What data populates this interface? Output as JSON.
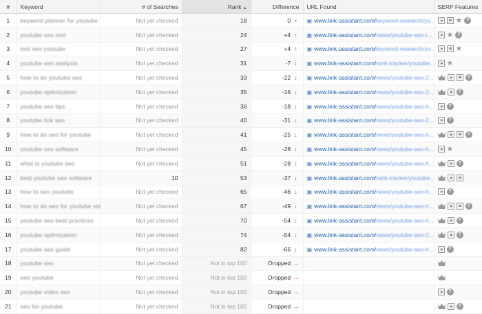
{
  "headers": {
    "num": "#",
    "keyword": "Keyword",
    "searches": "# of Searches",
    "rank": "Rank",
    "difference": "Difference",
    "url": "URL Found",
    "serp": "SERP Features"
  },
  "sort_indicator": "▲",
  "url_domain": "www.link-assistant.com/",
  "rows": [
    {
      "num": "1",
      "keyword": "keyword planner for youtube",
      "searches": "Not yet checked",
      "rank": "18",
      "diff": "0",
      "dir": "none",
      "url_path": "keyword-research/yo...",
      "serp": [
        "play",
        "doc",
        "star",
        "q"
      ]
    },
    {
      "num": "2",
      "keyword": "youtube seo tool",
      "searches": "Not yet checked",
      "rank": "24",
      "diff": "+4",
      "dir": "up",
      "url_path": "news/youtube-seo-t...",
      "serp": [
        "play",
        "star",
        "q"
      ]
    },
    {
      "num": "3",
      "keyword": "tool seo youtube",
      "searches": "Not yet checked",
      "rank": "27",
      "diff": "+4",
      "dir": "up",
      "url_path": "keyword-research/yo...",
      "serp": [
        "play",
        "doc",
        "star"
      ]
    },
    {
      "num": "4",
      "keyword": "youtube seo analysis",
      "searches": "Not yet checked",
      "rank": "31",
      "diff": "-7",
      "dir": "down",
      "url_path": "rank-tracker/youtube...",
      "serp": [
        "play",
        "star"
      ]
    },
    {
      "num": "5",
      "keyword": "how to do youtube seo",
      "searches": "Not yet checked",
      "rank": "33",
      "diff": "-22",
      "dir": "down",
      "url_path": "news/youtube-seo-2...",
      "serp": [
        "crown",
        "play",
        "doc",
        "q"
      ]
    },
    {
      "num": "6",
      "keyword": "youtube optimization",
      "searches": "Not yet checked",
      "rank": "35",
      "diff": "-16",
      "dir": "down",
      "url_path": "news/youtube-seo-2...",
      "serp": [
        "crown",
        "play",
        "q"
      ]
    },
    {
      "num": "7",
      "keyword": "youtube seo tips",
      "searches": "Not yet checked",
      "rank": "36",
      "diff": "-18",
      "dir": "down",
      "url_path": "news/youtube-seo-h...",
      "serp": [
        "play",
        "q"
      ]
    },
    {
      "num": "8",
      "keyword": "youtube link seo",
      "searches": "Not yet checked",
      "rank": "40",
      "diff": "-31",
      "dir": "down",
      "url_path": "news/youtube-seo-2...",
      "serp": [
        "play",
        "q"
      ]
    },
    {
      "num": "9",
      "keyword": "how to do seo for youtube",
      "searches": "Not yet checked",
      "rank": "41",
      "diff": "-25",
      "dir": "down",
      "url_path": "news/youtube-seo-h...",
      "serp": [
        "crown",
        "play",
        "doc",
        "q"
      ]
    },
    {
      "num": "10",
      "keyword": "youtube seo software",
      "searches": "Not yet checked",
      "rank": "45",
      "diff": "-28",
      "dir": "down",
      "url_path": "news/youtube-seo-h...",
      "serp": [
        "play",
        "star"
      ]
    },
    {
      "num": "11",
      "keyword": "what is youtube seo",
      "searches": "Not yet checked",
      "rank": "51",
      "diff": "-28",
      "dir": "down",
      "url_path": "news/youtube-seo-h...",
      "serp": [
        "crown",
        "play",
        "q"
      ]
    },
    {
      "num": "12",
      "keyword": "best youtube seo software",
      "searches": "10",
      "rank": "53",
      "diff": "-37",
      "dir": "down",
      "url_path": "rank-tracker/youtube...",
      "serp": [
        "crown",
        "play",
        "doc"
      ]
    },
    {
      "num": "13",
      "keyword": "how to seo youtube",
      "searches": "Not yet checked",
      "rank": "65",
      "diff": "-46",
      "dir": "down",
      "url_path": "news/youtube-seo-h...",
      "serp": [
        "play",
        "q"
      ]
    },
    {
      "num": "14",
      "keyword": "how to do seo for youtube videos",
      "searches": "Not yet checked",
      "rank": "67",
      "diff": "-49",
      "dir": "down",
      "url_path": "news/youtube-seo-h...",
      "serp": [
        "crown",
        "play",
        "doc",
        "q"
      ]
    },
    {
      "num": "15",
      "keyword": "youtube seo best practices",
      "searches": "Not yet checked",
      "rank": "70",
      "diff": "-54",
      "dir": "down",
      "url_path": "news/youtube-seo-h...",
      "serp": [
        "crown",
        "play",
        "q"
      ]
    },
    {
      "num": "16",
      "keyword": "youtube optimization",
      "searches": "Not yet checked",
      "rank": "74",
      "diff": "-54",
      "dir": "down",
      "url_path": "news/youtube-seo-2...",
      "serp": [
        "crown",
        "play",
        "q"
      ]
    },
    {
      "num": "17",
      "keyword": "youtube seo guide",
      "searches": "Not yet checked",
      "rank": "82",
      "diff": "-66",
      "dir": "down",
      "url_path": "news/youtube-seo-h...",
      "serp": [
        "play",
        "q"
      ]
    },
    {
      "num": "18",
      "keyword": "youtube seo",
      "searches": "Not yet checked",
      "rank": "Not in top 100",
      "diff": "Dropped",
      "dir": "drop",
      "url_path": "",
      "serp": [
        "crown"
      ]
    },
    {
      "num": "19",
      "keyword": "seo youtube",
      "searches": "Not yet checked",
      "rank": "Not in top 100",
      "diff": "Dropped",
      "dir": "drop",
      "url_path": "",
      "serp": [
        "crown"
      ]
    },
    {
      "num": "20",
      "keyword": "youtube video seo",
      "searches": "Not yet checked",
      "rank": "Not in top 100",
      "diff": "Dropped",
      "dir": "drop",
      "url_path": "",
      "serp": [
        "play",
        "q"
      ]
    },
    {
      "num": "21",
      "keyword": "seo for youtube",
      "searches": "Not yet checked",
      "rank": "Not in top 100",
      "diff": "Dropped",
      "dir": "drop",
      "url_path": "",
      "serp": [
        "crown",
        "play",
        "q"
      ]
    }
  ]
}
